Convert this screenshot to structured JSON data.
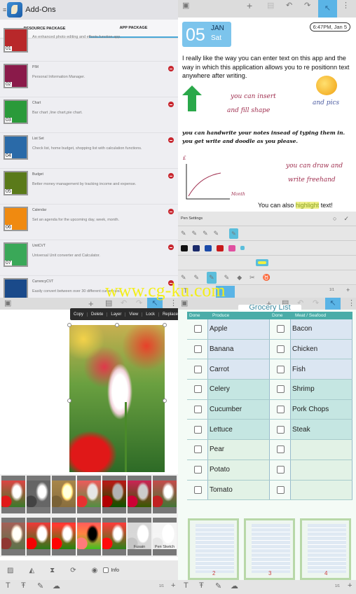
{
  "watermark": "www.cg-ku.com",
  "addons": {
    "title": "Add-Ons",
    "tabs": [
      {
        "label": "RESOURCE PACKAGE",
        "active": false
      },
      {
        "label": "APP PACKAGE",
        "active": true
      }
    ],
    "items": [
      {
        "num": "01",
        "name": "",
        "desc": "An enhanced photo editing and effects function app.",
        "color": "#b8282a"
      },
      {
        "num": "02",
        "name": "PIM",
        "desc": "Personal Information Manager.",
        "color": "#8a1a4a"
      },
      {
        "num": "03",
        "name": "Chart",
        "desc": "Bar chart ,line chart,pie chart.",
        "color": "#2a9a3a"
      },
      {
        "num": "04",
        "name": "List Set",
        "desc": "Check list, home budget, shopping list with calculation functions.",
        "color": "#2a6aa8"
      },
      {
        "num": "05",
        "name": "Budget",
        "desc": "Better money management by tracking income and expense.",
        "color": "#5a7a1a"
      },
      {
        "num": "06",
        "name": "Calendar",
        "desc": "Set an agenda for the upcoming day, week, month.",
        "color": "#f08a10"
      },
      {
        "num": "07",
        "name": "UnitCVT",
        "desc": "Universal Unit converter and Calculator.",
        "color": "#3aa858"
      },
      {
        "num": "",
        "name": "CurrencyCVT",
        "desc": "Easily convert between over 30 different currencies.",
        "color": "#1a4a8a"
      }
    ]
  },
  "note": {
    "date_day": "05",
    "date_month": "JAN",
    "date_weekday": "Sat",
    "timestamp": "6:47PM, Jan 5",
    "typed_text": "I really like the way you can enter text on this app and the way in which this application allows you to re positionn text anywhere after writing.",
    "hw1": "you can insert",
    "hw2": "and fill shape",
    "hw3": "and pics",
    "hw4": "you can handwrite your notes insead of typing them in.",
    "hw5": "you get write and doodle as you please.",
    "hw6": "you can draw and",
    "hw7": "write freehand",
    "axis_y": "£",
    "axis_x": "Month",
    "hl_before": "You can also",
    "hl_word": "highlight",
    "hl_after": "text!",
    "pen_settings": "Pen Settings",
    "colors": [
      "#111111",
      "#1a2a6a",
      "#1a4aa8",
      "#c81a1a",
      "#e050a0",
      "#f0f040"
    ],
    "page": "1/1"
  },
  "photo": {
    "context_menu": [
      "Copy",
      "Delete",
      "Layer",
      "View",
      "Lock",
      "Replace"
    ],
    "filters": [
      "",
      "",
      "",
      "",
      "",
      "",
      "",
      "",
      "",
      "",
      "",
      "",
      "Fusain",
      "Pen Sketch"
    ],
    "info_label": "Info",
    "page": "1/1"
  },
  "grocery": {
    "title": "Grocery List",
    "headers": [
      "Done",
      "Produce",
      "Done",
      "Meat / Seafood"
    ],
    "produce": [
      "Apple",
      "Banana",
      "Carrot",
      "Celery",
      "Cucumber",
      "Lettuce",
      "Pear",
      "Potato",
      "Tomato"
    ],
    "meat": [
      "Bacon",
      "Chicken",
      "Fish",
      "Shrimp",
      "Pork Chops",
      "Steak",
      "",
      "",
      ""
    ],
    "pages": [
      "2",
      "3",
      "4"
    ],
    "page": "1/1"
  }
}
